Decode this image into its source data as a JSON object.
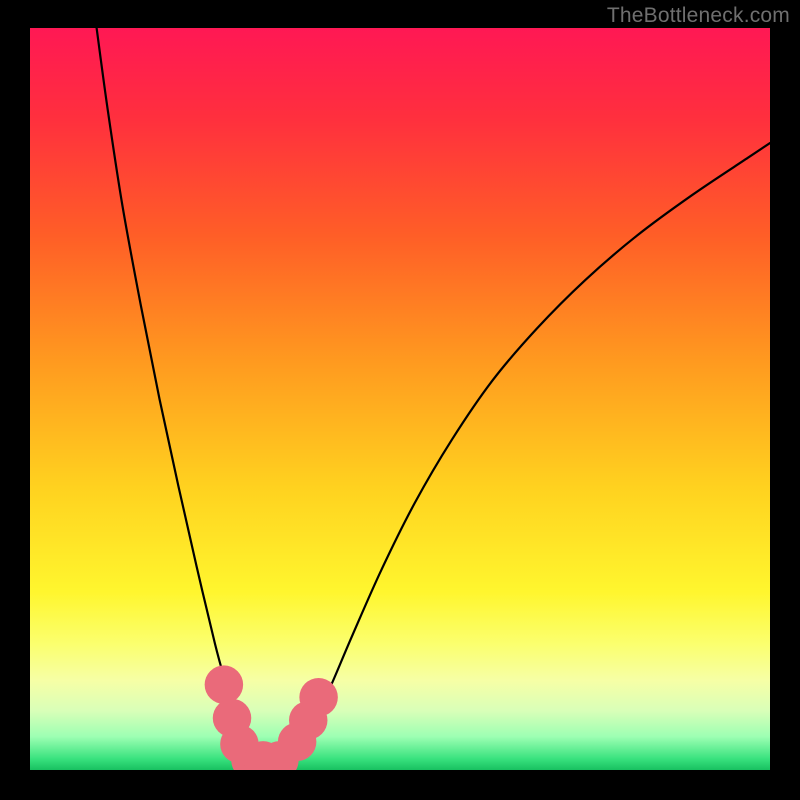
{
  "watermark": "TheBottleneck.com",
  "chart_data": {
    "type": "line",
    "title": "",
    "xlabel": "",
    "ylabel": "",
    "xlim": [
      0,
      100
    ],
    "ylim": [
      0,
      100
    ],
    "gradient_stops": [
      {
        "offset": 0.0,
        "color": "#ff1854"
      },
      {
        "offset": 0.12,
        "color": "#ff2f3e"
      },
      {
        "offset": 0.28,
        "color": "#ff5e27"
      },
      {
        "offset": 0.45,
        "color": "#ff9a1f"
      },
      {
        "offset": 0.62,
        "color": "#ffd21f"
      },
      {
        "offset": 0.76,
        "color": "#fff62e"
      },
      {
        "offset": 0.83,
        "color": "#fbff6e"
      },
      {
        "offset": 0.88,
        "color": "#f6ffa6"
      },
      {
        "offset": 0.92,
        "color": "#d9ffb8"
      },
      {
        "offset": 0.955,
        "color": "#9dffb3"
      },
      {
        "offset": 0.985,
        "color": "#39e27e"
      },
      {
        "offset": 1.0,
        "color": "#18c060"
      }
    ],
    "series": [
      {
        "name": "curve",
        "x": [
          9.0,
          10.5,
          12.5,
          15.0,
          17.5,
          20.0,
          22.5,
          25.0,
          26.5,
          27.5,
          28.5,
          29.2,
          30.0,
          31.0,
          32.5,
          34.0,
          35.5,
          37.0,
          38.5,
          40.5,
          43.5,
          47.5,
          52.0,
          57.0,
          62.5,
          68.5,
          75.0,
          82.0,
          89.5,
          97.0,
          100.0
        ],
        "y": [
          100.0,
          89.0,
          76.0,
          62.5,
          50.0,
          38.5,
          27.5,
          17.0,
          11.5,
          8.0,
          5.0,
          3.0,
          1.8,
          1.2,
          1.2,
          1.5,
          2.5,
          4.5,
          7.0,
          11.0,
          18.0,
          27.0,
          36.0,
          44.5,
          52.5,
          59.5,
          66.0,
          72.0,
          77.5,
          82.5,
          84.5
        ]
      }
    ],
    "markers": [
      {
        "x": 26.2,
        "y": 11.5
      },
      {
        "x": 27.3,
        "y": 7.0
      },
      {
        "x": 28.3,
        "y": 3.5
      },
      {
        "x": 29.8,
        "y": 1.3
      },
      {
        "x": 31.5,
        "y": 1.3
      },
      {
        "x": 33.7,
        "y": 1.3
      },
      {
        "x": 36.1,
        "y": 3.8
      },
      {
        "x": 37.6,
        "y": 6.7
      },
      {
        "x": 39.0,
        "y": 9.8
      }
    ],
    "marker_style": {
      "fill": "#ea6a7a",
      "r": 2.6
    }
  }
}
